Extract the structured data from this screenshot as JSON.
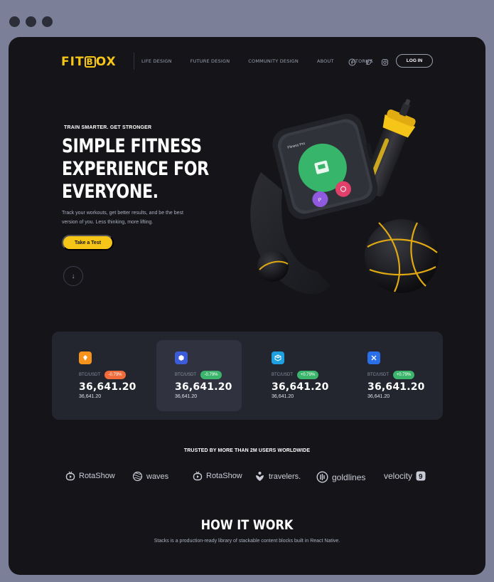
{
  "brand": {
    "logo_text": "FITBOX",
    "logo_prefix": "FIT",
    "logo_box": "B",
    "logo_suffix": "OX",
    "accent": "#f5c518"
  },
  "nav": {
    "items": [
      "LIFE DESIGN",
      "FUTURE DESIGN",
      "COMMUNITY DESIGN",
      "ABOUT",
      "STORIES"
    ],
    "social_icons": [
      "facebook-icon",
      "twitter-icon",
      "instagram-icon"
    ],
    "login_label": "LOG IN"
  },
  "hero": {
    "eyebrow": "TRAIN SMARTER. GET STRONGER",
    "headline_lines": [
      "SIMPLE FITNESS",
      "EXPERIENCE FOR",
      "EVERYONE."
    ],
    "subtitle": "Track your workouts, get better results, and be the best version of you. Less thinking, more lifting.",
    "cta_label": "Take a Test",
    "scroll_icon": "arrow-down-icon",
    "watch_app_label": "Fitness Pro"
  },
  "stats": [
    {
      "icon": "bnb-coin-icon",
      "color": "#f7931a",
      "pair": "BTC/USDT",
      "change": "-0.79%",
      "change_color": "#f26b3a",
      "price": "36,641.20",
      "price_sub": "36,641.20",
      "active": false
    },
    {
      "icon": "hex-coin-icon",
      "color": "#3c5bd6",
      "pair": "BTC/USDT",
      "change": "-0.79%",
      "change_color": "#3bb56b",
      "price": "36,641.20",
      "price_sub": "36,641.20",
      "active": true
    },
    {
      "icon": "cube-coin-icon",
      "color": "#1e9fe0",
      "pair": "BTC/USDT",
      "change": "+0.79%",
      "change_color": "#3bb56b",
      "price": "36,641.20",
      "price_sub": "36,641.20",
      "active": false
    },
    {
      "icon": "x-coin-icon",
      "color": "#2a6fe8",
      "pair": "BTC/USDT",
      "change": "+0.79%",
      "change_color": "#3bb56b",
      "price": "36,641.20",
      "price_sub": "36,641.20",
      "active": false
    }
  ],
  "trusted": {
    "title": "TRUSTED BY MORE THAN 2M USERS WORLDWIDE",
    "brands": [
      "RotaShow",
      "waves",
      "RotaShow",
      "travelers.",
      "goldlines",
      "velocity"
    ]
  },
  "how": {
    "title": "HOW IT WORK",
    "subtitle": "Stacks is a production-ready library of stackable content blocks built in React Native."
  }
}
